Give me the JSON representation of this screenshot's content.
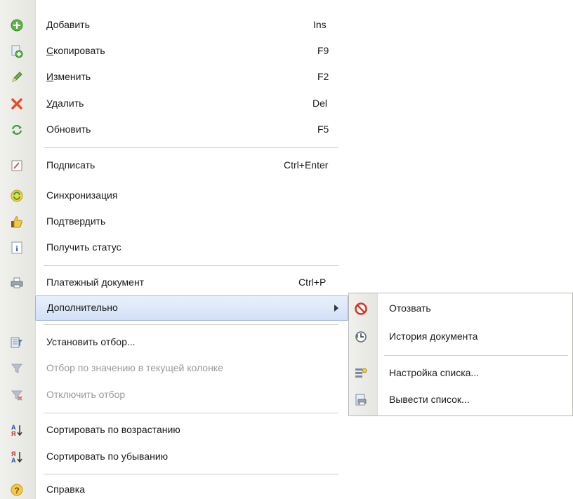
{
  "main_menu": {
    "items": [
      {
        "id": "add",
        "prefix_underlined": "Д",
        "rest": "обавить",
        "shortcut": "Ins",
        "icon": "add-icon"
      },
      {
        "id": "copy",
        "prefix_underlined": "С",
        "rest": "копировать",
        "shortcut": "F9",
        "icon": "copy-icon"
      },
      {
        "id": "edit",
        "prefix_underlined": "И",
        "rest": "зменить",
        "shortcut": "F2",
        "icon": "pencil-icon"
      },
      {
        "id": "delete",
        "prefix_underlined": "У",
        "rest": "далить",
        "shortcut": "Del",
        "icon": "delete-icon"
      },
      {
        "id": "refresh",
        "label": "Обновить",
        "shortcut": "F5",
        "icon": "refresh-icon"
      },
      {
        "id": "sign",
        "label": "Подписать",
        "shortcut": "Ctrl+Enter",
        "icon": "sign-icon"
      },
      {
        "id": "sync",
        "label": "Синхронизация",
        "icon": "sync-icon"
      },
      {
        "id": "confirm",
        "label": "Подтвердить",
        "icon": "thumbs-up-icon"
      },
      {
        "id": "status",
        "label": "Получить статус",
        "icon": "info-icon"
      },
      {
        "id": "payment",
        "label": "Платежный документ",
        "shortcut": "Ctrl+P",
        "icon": "print-icon"
      },
      {
        "id": "more",
        "label": "Дополнительно"
      },
      {
        "id": "set_filter",
        "label": "Установить отбор...",
        "icon": "filter-set-icon"
      },
      {
        "id": "filter_by_value",
        "label": "Отбор по значению в текущей колонке",
        "disabled": true,
        "icon": "filter-icon"
      },
      {
        "id": "disable_filter",
        "label": "Отключить отбор",
        "disabled": true,
        "icon": "filter-off-icon"
      },
      {
        "id": "sort_asc",
        "label": "Сортировать по возрастанию",
        "icon": "sort-asc-icon"
      },
      {
        "id": "sort_desc",
        "label": "Сортировать по убыванию",
        "icon": "sort-desc-icon"
      },
      {
        "id": "help",
        "label": "Справка",
        "icon": "help-icon"
      }
    ]
  },
  "submenu": {
    "items": [
      {
        "id": "revoke",
        "label": "Отозвать",
        "icon": "revoke-icon"
      },
      {
        "id": "history",
        "label": "История документа",
        "icon": "history-icon"
      },
      {
        "id": "list_settings",
        "label": "Настройка списка...",
        "icon": "list-settings-icon"
      },
      {
        "id": "print_list",
        "label": "Вывести список...",
        "icon": "print-list-icon"
      }
    ]
  },
  "colors": {
    "highlight_border": "#9fb6dd",
    "highlight_fill": "#d2e0f6",
    "disabled_text": "#9a9a9a",
    "add_green": "#4caf3c",
    "delete_red": "#e2502a",
    "revoke_red": "#e03020"
  }
}
